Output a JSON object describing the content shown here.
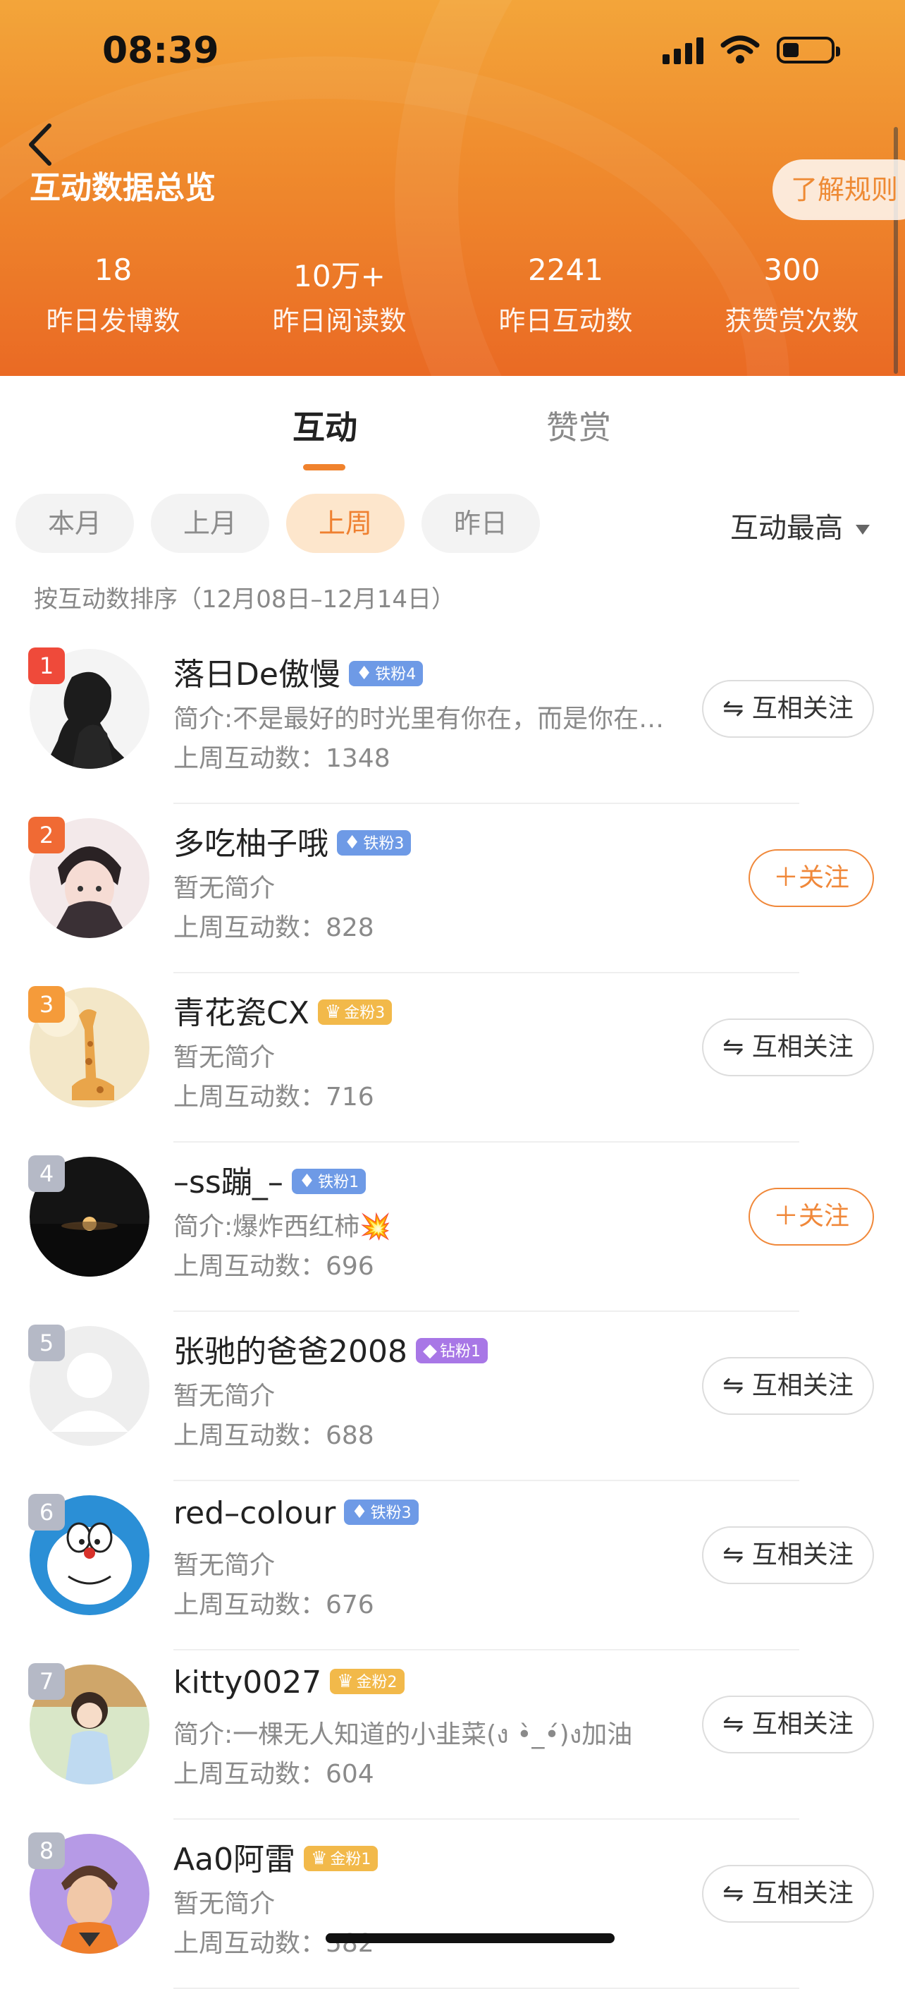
{
  "status_bar": {
    "time": "08:39"
  },
  "header": {
    "title": "互动数据总览",
    "rules_button": "了解规则",
    "stats": [
      {
        "value": "18",
        "label": "昨日发博数"
      },
      {
        "value": "10万+",
        "label": "昨日阅读数"
      },
      {
        "value": "2241",
        "label": "昨日互动数"
      },
      {
        "value": "300",
        "label": "获赞赏次数"
      }
    ]
  },
  "tabs": [
    {
      "label": "互动",
      "active": true
    },
    {
      "label": "赞赏",
      "active": false
    }
  ],
  "filters": {
    "chips": [
      {
        "label": "本月",
        "active": false
      },
      {
        "label": "上月",
        "active": false
      },
      {
        "label": "上周",
        "active": true
      },
      {
        "label": "昨日",
        "active": false
      }
    ],
    "sort_label": "互动最高"
  },
  "sort_note": "按互动数排序（12月08日–12月14日）",
  "colors": {
    "accent": "#f0822d",
    "rank_top": "#ef5a34",
    "rank_other": "#b5b9c6"
  },
  "users": [
    {
      "rank": "1",
      "name": "落日De傲慢",
      "badge": "铁粉4",
      "badge_color": "#6e9ae6",
      "bio": "简介:不是最好的时光里有你在，而是你在…",
      "count": "上周互动数：1348",
      "follow": "⇋ 互相关注",
      "follow_type": "mutual",
      "avatar": "silhouette"
    },
    {
      "rank": "2",
      "name": "多吃柚子哦",
      "badge": "铁粉3",
      "badge_color": "#6e9ae6",
      "bio": "暂无简介",
      "count": "上周互动数：828",
      "follow": "＋关注",
      "follow_type": "add",
      "avatar": "anime-boy"
    },
    {
      "rank": "3",
      "name": "青花瓷CX",
      "badge": "金粉3",
      "badge_color": "#f2b94a",
      "bio": "暂无简介",
      "count": "上周互动数：716",
      "follow": "⇋ 互相关注",
      "follow_type": "mutual",
      "avatar": "giraffe"
    },
    {
      "rank": "4",
      "name": "–ss蹦_–",
      "badge": "铁粉1",
      "badge_color": "#6e9ae6",
      "bio": "简介:爆炸西红柿💥",
      "count": "上周互动数：696",
      "follow": "＋关注",
      "follow_type": "add",
      "avatar": "sunset"
    },
    {
      "rank": "5",
      "name": "张驰的爸爸2008",
      "badge": "钻粉1",
      "badge_color": "#a877e6",
      "bio": "暂无简介",
      "count": "上周互动数：688",
      "follow": "⇋ 互相关注",
      "follow_type": "mutual",
      "avatar": "default"
    },
    {
      "rank": "6",
      "name": "red–colour",
      "badge": "铁粉3",
      "badge_color": "#6e9ae6",
      "bio": "暂无简介",
      "count": "上周互动数：676",
      "follow": "⇋ 互相关注",
      "follow_type": "mutual",
      "avatar": "doraemon"
    },
    {
      "rank": "7",
      "name": "kitty0027",
      "badge": "金粉2",
      "badge_color": "#f2b94a",
      "bio": "简介:一棵无人知道的小韭菜(ง •̀_•́)ง加油",
      "count": "上周互动数：604",
      "follow": "⇋ 互相关注",
      "follow_type": "mutual",
      "avatar": "girl"
    },
    {
      "rank": "8",
      "name": "Aa0阿雷",
      "badge": "金粉1",
      "badge_color": "#f2b94a",
      "bio": "暂无简介",
      "count": "上周互动数：582",
      "follow": "⇋ 互相关注",
      "follow_type": "mutual",
      "avatar": "cartoon-man"
    }
  ]
}
